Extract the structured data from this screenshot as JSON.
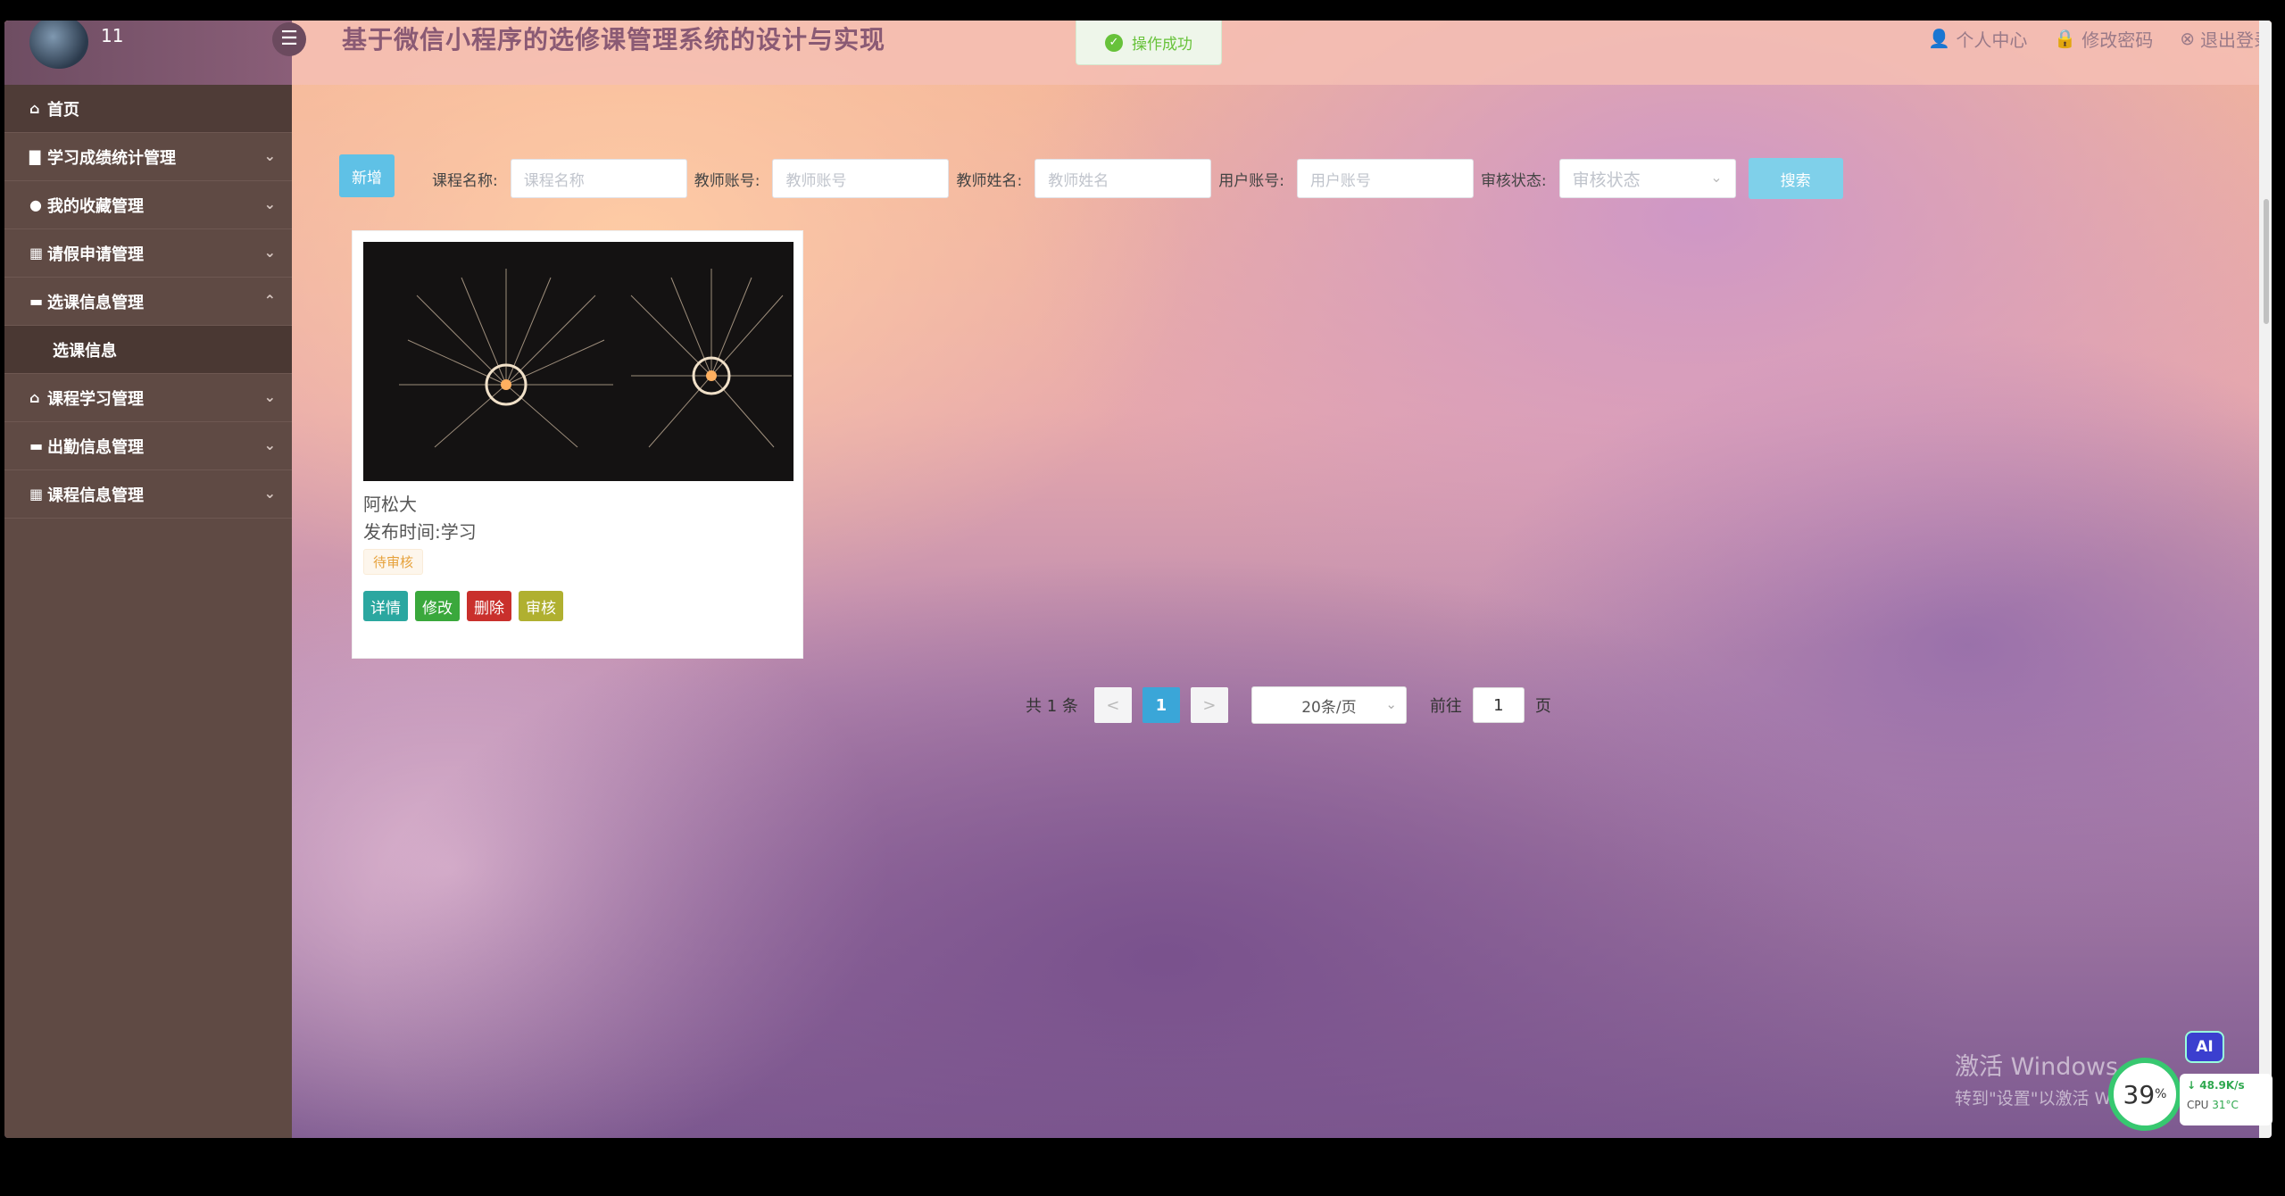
{
  "header": {
    "username": "11",
    "menu_toggle_icon": "hamburger-icon",
    "title": "基于微信小程序的选修课管理系统的设计与实现",
    "toast": "操作成功",
    "nav": {
      "profile": "个人中心",
      "change_password": "修改密码",
      "logout": "退出登录"
    }
  },
  "sidebar": {
    "home": "首页",
    "items": [
      {
        "label": "学习成绩统计管理"
      },
      {
        "label": "我的收藏管理"
      },
      {
        "label": "请假申请管理"
      },
      {
        "label": "选课信息管理"
      },
      {
        "label": "课程学习管理"
      },
      {
        "label": "出勤信息管理"
      },
      {
        "label": "课程信息管理"
      }
    ],
    "sub_item": "选课信息"
  },
  "search": {
    "add_label": "新增",
    "course_label": "课程名称:",
    "course_placeholder": "课程名称",
    "teacher_account_label": "教师账号:",
    "teacher_account_placeholder": "教师账号",
    "teacher_name_label": "教师姓名:",
    "teacher_name_placeholder": "教师姓名",
    "user_account_label": "用户账号:",
    "user_account_placeholder": "用户账号",
    "status_label": "审核状态:",
    "status_placeholder": "审核状态",
    "search_label": "搜索"
  },
  "card": {
    "title": "阿松大",
    "meta": "发布时间:学习",
    "badge": "待审核",
    "actions": {
      "detail": "详情",
      "edit": "修改",
      "delete": "删除",
      "audit": "审核"
    }
  },
  "pagination": {
    "total": "共 1 条",
    "prev": "<",
    "current": "1",
    "next": ">",
    "page_size": "20条/页",
    "goto_label": "前往",
    "goto_value": "1",
    "page_suffix": "页"
  },
  "overlay": {
    "watermark_line1": "激活 Windows",
    "watermark_line2": "转到\"设置\"以激活 Windows",
    "ai": "AI",
    "cpu_percent": "39",
    "cpu_percent_sign": "%",
    "net_speed": "48.9K/s",
    "cpu_label": "CPU",
    "cpu_temp": "31°C"
  },
  "colors": {
    "sidebar_bg": "#5f4a44",
    "accent_blue": "#5fc1e6",
    "success": "#67c23a",
    "danger": "#c9302c",
    "title": "#8a5a74"
  }
}
